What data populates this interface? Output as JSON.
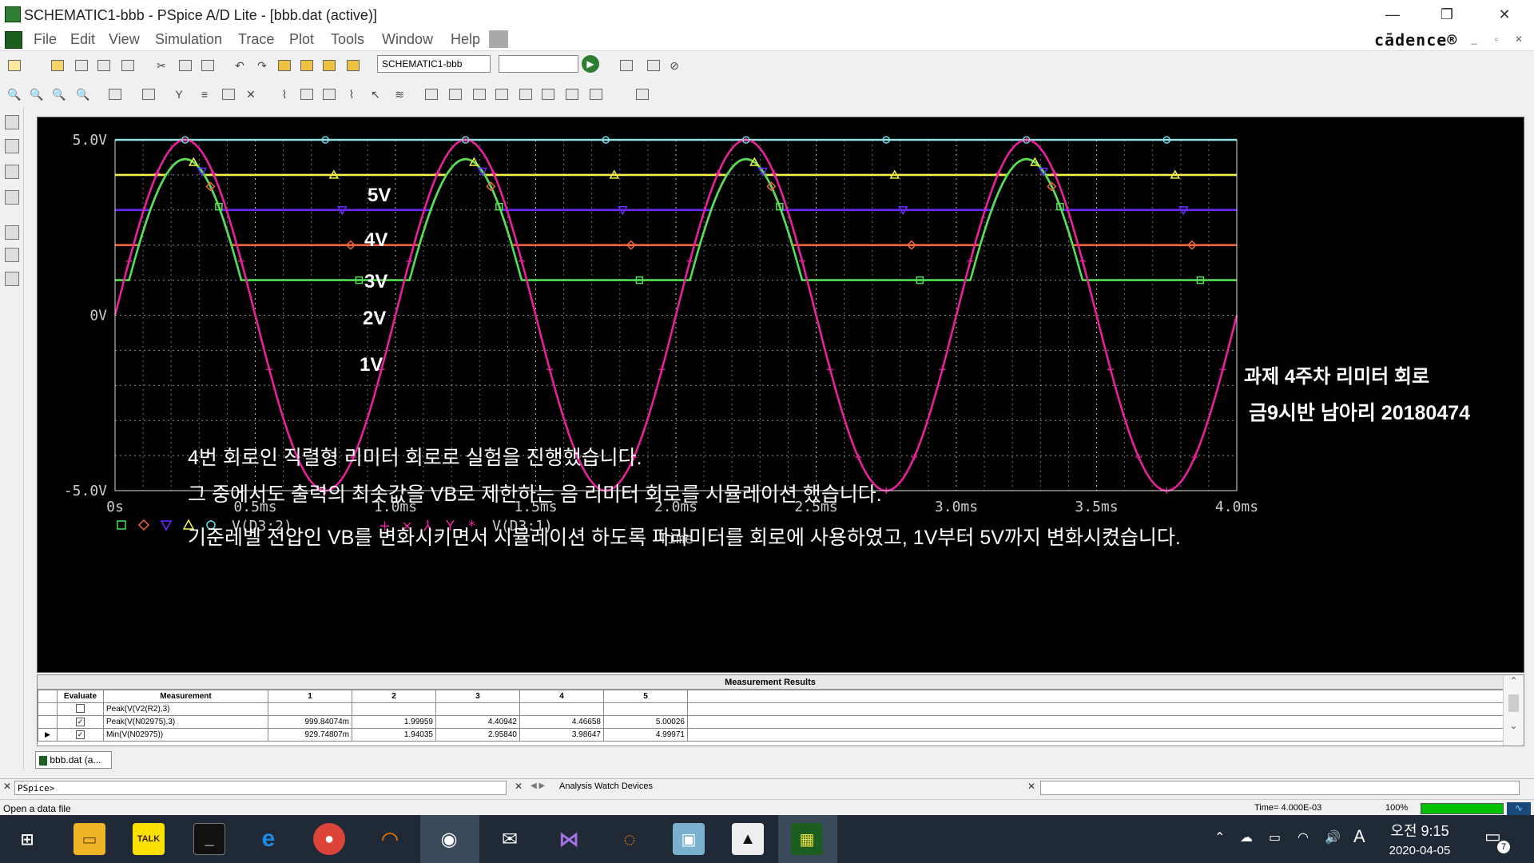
{
  "window": {
    "title": "SCHEMATIC1-bbb - PSpice A/D Lite - [bbb.dat (active)]",
    "brand": "cādence®"
  },
  "menu": [
    "File",
    "Edit",
    "View",
    "Simulation",
    "Trace",
    "Plot",
    "Tools",
    "Window",
    "Help"
  ],
  "toolbar": {
    "schematic_field": "SCHEMATIC1-bbb"
  },
  "plot": {
    "y_ticks": [
      "5.0V",
      "0V",
      "-5.0V"
    ],
    "x_ticks": [
      "0s",
      "0.5ms",
      "1.0ms",
      "1.5ms",
      "2.0ms",
      "2.5ms",
      "3.0ms",
      "3.5ms",
      "4.0ms"
    ],
    "x_label": "Time",
    "legend_label_1": "V(D3:2)",
    "legend_label_2": "V(D3:1)",
    "level_labels": [
      "5V",
      "4V",
      "3V",
      "2V",
      "1V"
    ],
    "title_line_1": "과제 4주차 리미터 회로",
    "title_line_2": "금9시반 남아리 20180474",
    "notes": [
      "4번 회로인 직렬형 리미터 회로로 실험을 진행했습니다.",
      "그 중에서도 출력의 최솟값을 VB로 제한하는 음 리미터 회로를 시뮬레이션 했습니다.",
      "기준레벨 전압인 VB를 변화시키면서 시뮬레이션 하도록 파라미터를 회로에 사용하였고, 1V부터 5V까지 변화시켰습니다."
    ],
    "colors": {
      "cyan": "#5ce1e6",
      "yellow": "#f2f24a",
      "violet": "#6a2bff",
      "orange": "#f0643c",
      "green": "#52e052",
      "magenta": "#e6219b",
      "grid": "#cccccc"
    }
  },
  "chart_data": {
    "type": "line",
    "xlabel": "Time",
    "ylabel": "",
    "xlim": [
      0,
      4.0
    ],
    "x_unit": "ms",
    "ylim": [
      -5.0,
      5.0
    ],
    "series": [
      {
        "name": "V(D3:1)",
        "shape": "sine",
        "amplitude": 5.0,
        "period_ms": 1.0,
        "color": "#e6219b"
      },
      {
        "name": "V(D3:2)",
        "clip": 5.0,
        "color": "#5ce1e6"
      },
      {
        "name": "V(D3:2)",
        "clip": 4.0,
        "color": "#f2f24a"
      },
      {
        "name": "V(D3:2)",
        "clip": 3.0,
        "color": "#6a2bff"
      },
      {
        "name": "V(D3:2)",
        "clip": 2.0,
        "color": "#f0643c"
      },
      {
        "name": "V(D3:2)",
        "clip": 1.0,
        "color": "#52e052"
      }
    ]
  },
  "measurement": {
    "header": "Measurement Results",
    "columns": [
      "Evaluate",
      "Measurement",
      "1",
      "2",
      "3",
      "4",
      "5"
    ],
    "rows": [
      {
        "checked": false,
        "name": "Peak(V(V2(R2),3)",
        "values": [
          "",
          "",
          "",
          "",
          ""
        ]
      },
      {
        "checked": true,
        "name": "Peak(V(N02975),3)",
        "values": [
          "999.84074m",
          "1.99959",
          "4.40942",
          "4.46658",
          "5.00026"
        ]
      },
      {
        "checked": true,
        "name": "Min(V(N02975))",
        "values": [
          "929.74807m",
          "1.94035",
          "2.95840",
          "3.98647",
          "4.99971"
        ]
      }
    ]
  },
  "doc_tab": "bbb.dat (a...",
  "command": {
    "prompt": "PSpice>",
    "tabs": "Analysis  Watch  Devices"
  },
  "status": {
    "left": "Open a data file",
    "time": "Time= 4.000E-03",
    "zoom": "100%"
  },
  "taskbar": {
    "time": "오전 9:15",
    "date": "2020-04-05",
    "ime": "A",
    "notif_count": "7"
  }
}
